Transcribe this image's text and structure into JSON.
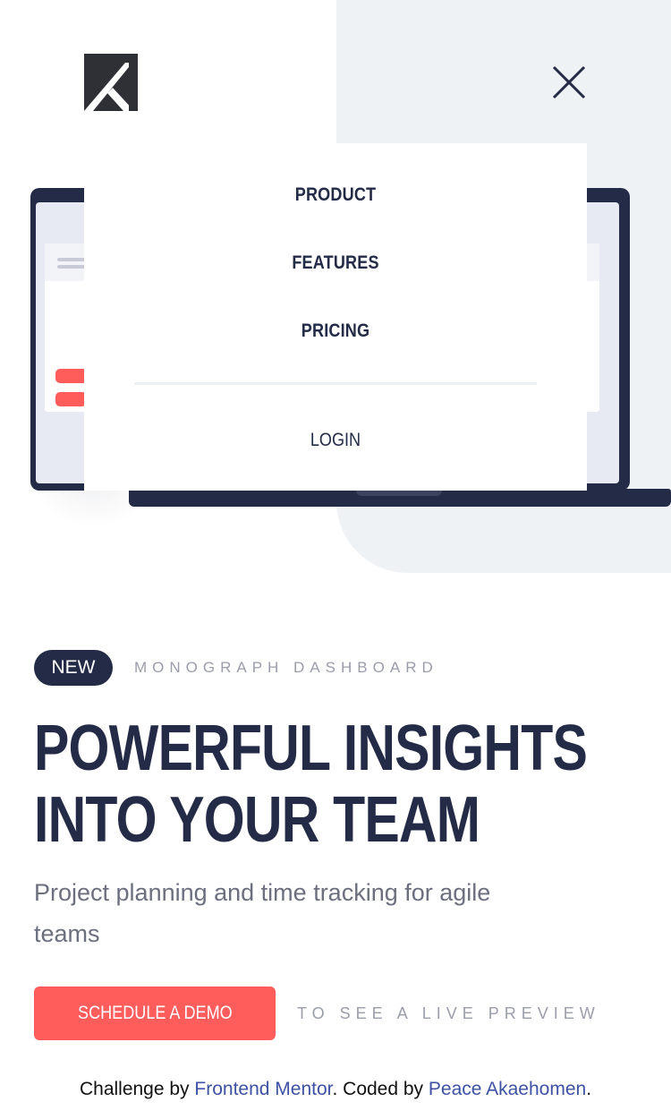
{
  "logo": {
    "icon": "monograph-k-logo-icon"
  },
  "close_icon": "close-icon",
  "nav": {
    "items": [
      {
        "label": "PRODUCT"
      },
      {
        "label": "FEATURES"
      },
      {
        "label": "PRICING"
      }
    ],
    "login_label": "LOGIN"
  },
  "hero": {
    "badge": "NEW",
    "tagline": "MONOGRAPH DASHBOARD",
    "headline_line1": "POWERFUL INSIGHTS",
    "headline_line2": "INTO YOUR TEAM",
    "subtitle": "Project planning and time tracking for agile teams",
    "cta_label": "SCHEDULE A DEMO",
    "preview_text": "TO SEE A LIVE PREVIEW"
  },
  "attribution": {
    "prefix": "Challenge by ",
    "link1": "Frontend Mentor",
    "middle": ". Coded by ",
    "link2": "Peace Akaehomen",
    "suffix": "."
  },
  "colors": {
    "navy": "#242b46",
    "accent_red": "#ff5c5c",
    "panel_gray": "#eef2f5",
    "muted_text": "#9b9daa",
    "link_blue": "#3e52a3"
  }
}
